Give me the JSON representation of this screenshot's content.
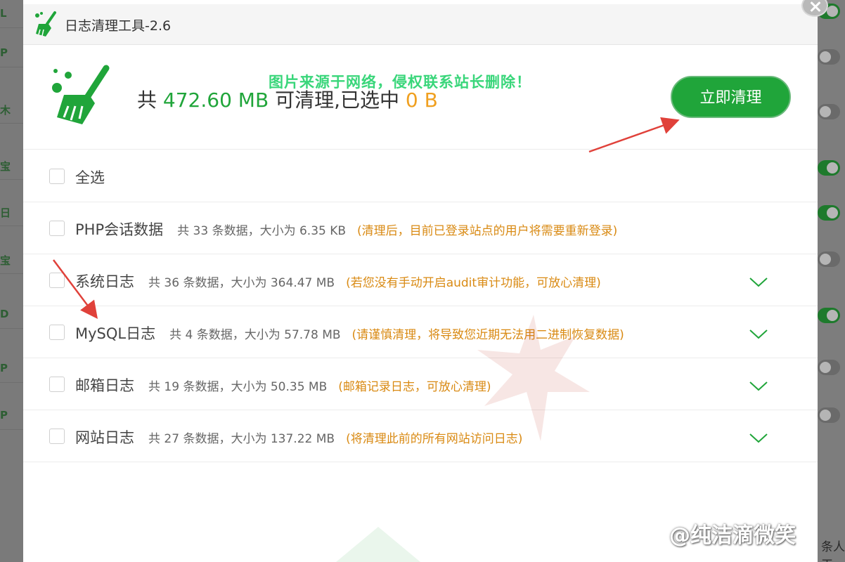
{
  "dialog": {
    "title": "日志清理工具-2.6",
    "header": {
      "total_prefix": "共",
      "total_size": "472.60 MB",
      "middle_text": "可清理,已选中",
      "selected_size": "0 B",
      "clean_button_label": "立即清理"
    },
    "select_all_label": "全选",
    "items": [
      {
        "name": "PHP会话数据",
        "meta": "共 33 条数据，大小为 6.35 KB",
        "note": "(清理后，目前已登录站点的用户将需要重新登录)",
        "expandable": false
      },
      {
        "name": "系统日志",
        "meta": "共 36 条数据，大小为 364.47 MB",
        "note": "(若您没有手动开启audit审计功能，可放心清理)",
        "expandable": true
      },
      {
        "name": "MySQL日志",
        "meta": "共 4 条数据，大小为 57.78 MB",
        "note": "(请谨慎清理，将导致您近期无法用二进制恢复数据)",
        "expandable": true
      },
      {
        "name": "邮箱日志",
        "meta": "共 19 条数据，大小为 50.35 MB",
        "note": "(邮箱记录日志，可放心清理)",
        "expandable": true
      },
      {
        "name": "网站日志",
        "meta": "共 27 条数据，大小为 137.22 MB",
        "note": "(将清理此前的所有网站访问日志)",
        "expandable": true
      }
    ]
  },
  "watermarks": {
    "top": "图片来源于网络，侵权联系站长删除！",
    "bottom": "@纯洁滴微笑"
  },
  "backdrop": {
    "left_letters": [
      "L",
      "P",
      "木",
      "宝",
      "日",
      "宝",
      "D",
      "P",
      "P"
    ],
    "bottom_right_text": "条人工"
  },
  "colors": {
    "accent": "#20a53a",
    "warning": "#d98a13",
    "selected": "#f0a020",
    "arrow": "#e0413a"
  }
}
